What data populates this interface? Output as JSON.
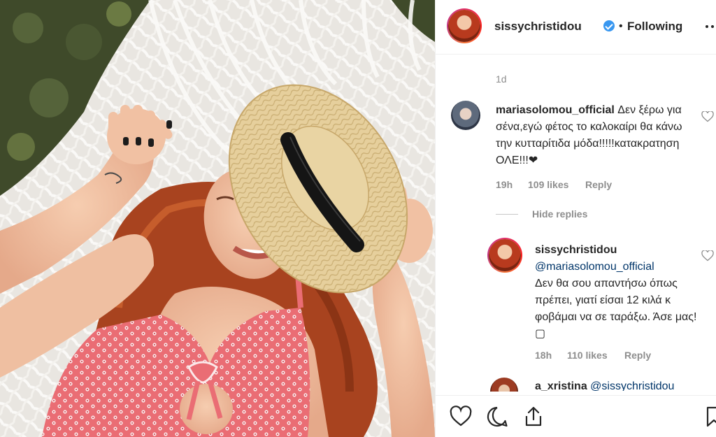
{
  "post": {
    "username": "sissychristidou",
    "separator": "•",
    "follow_status": "Following",
    "age": "1d"
  },
  "comments": [
    {
      "username": "mariasolomou_official",
      "text": "Δεν ξέρω για σένα,εγώ φέτος το καλοκαίρι θα κάνω την κυτταρίτιδα μόδα!!!!!κατακρατηση ΟΛΕ!!!❤",
      "time": "19h",
      "likes": "109 likes",
      "reply_label": "Reply",
      "hide_replies_label": "Hide replies"
    }
  ],
  "reply": {
    "username": "sissychristidou",
    "mention": "@mariasolomou_official",
    "text": "Δεν θα σου απαντήσω όπως πρέπει, γιατί είσαι 12 κιλά κ φοβάμαι να σε ταράξω. Άσε μας! ▢",
    "time": "18h",
    "likes": "110 likes",
    "reply_label": "Reply"
  },
  "partial_comment": {
    "username": "a_xristina",
    "mention": "@sissychristidou"
  },
  "colors": {
    "verified": "#3897f0",
    "secondary_text": "#8e8e8e",
    "mention": "#003569"
  },
  "icons": [
    "heart-icon",
    "comment-icon",
    "share-icon",
    "bookmark-icon",
    "more-options-icon",
    "verified-badge-icon"
  ]
}
